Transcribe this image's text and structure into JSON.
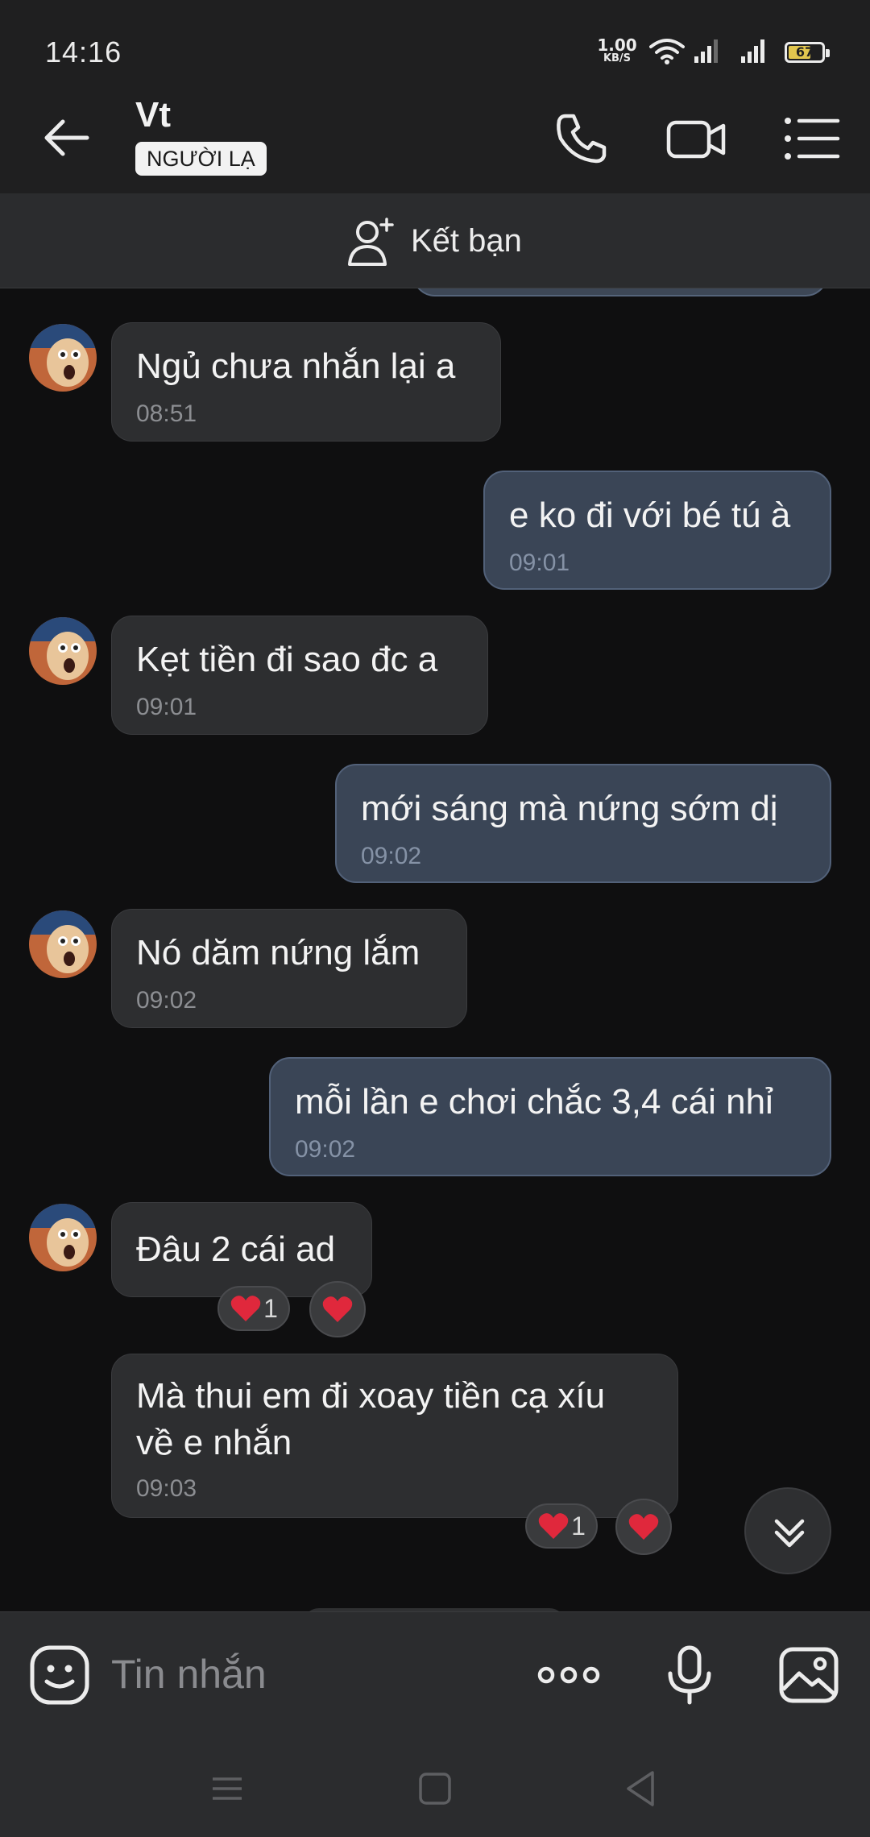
{
  "status_bar": {
    "time": "14:16",
    "net_speed_value": "1.00",
    "net_speed_unit": "KB/S",
    "battery": "67",
    "icons": [
      "wifi-icon",
      "signal-icon",
      "signal-icon",
      "battery-icon"
    ]
  },
  "header": {
    "name": "Vt",
    "badge": "NGƯỜI LẠ",
    "icons": [
      "back-arrow-icon",
      "phone-icon",
      "video-icon",
      "menu-list-icon"
    ]
  },
  "friend_bar": {
    "label": "Kết bạn",
    "icon": "add-user-icon"
  },
  "messages": [
    {
      "dir": "in",
      "text": "Ngủ chưa nhắn lại a",
      "time": "08:51"
    },
    {
      "dir": "out",
      "text": "e ko đi với bé tú à",
      "time": "09:01"
    },
    {
      "dir": "in",
      "text": "Kẹt tiền đi sao đc a",
      "time": "09:01"
    },
    {
      "dir": "out",
      "text": "mới sáng mà nứng sớm dị",
      "time": "09:02"
    },
    {
      "dir": "in",
      "text": "Nó dăm nứng lắm",
      "time": "09:02"
    },
    {
      "dir": "out",
      "text": "mỗi lần e chơi chắc 3,4 cái nhỉ",
      "time": "09:02"
    },
    {
      "dir": "in",
      "text": "Đâu 2 cái ad",
      "time": "",
      "reaction_count": "1"
    },
    {
      "dir": "in",
      "text_line1": "Mà thui em đi xoay tiền cạ xíu",
      "text_line2": "về e nhắn",
      "time": "09:03",
      "reaction_count": "1"
    }
  ],
  "composer": {
    "placeholder": "Tin nhắn",
    "icons": [
      "sticker-icon",
      "more-icon",
      "mic-icon",
      "image-icon"
    ]
  },
  "navbar": {
    "icons": [
      "recents-icon",
      "home-icon",
      "back-icon"
    ]
  },
  "colors": {
    "background": "#0f0f10",
    "incoming_bubble": "#2d2e30",
    "outgoing_bubble": "#3a4556",
    "reaction_heart": "#e0283c"
  }
}
